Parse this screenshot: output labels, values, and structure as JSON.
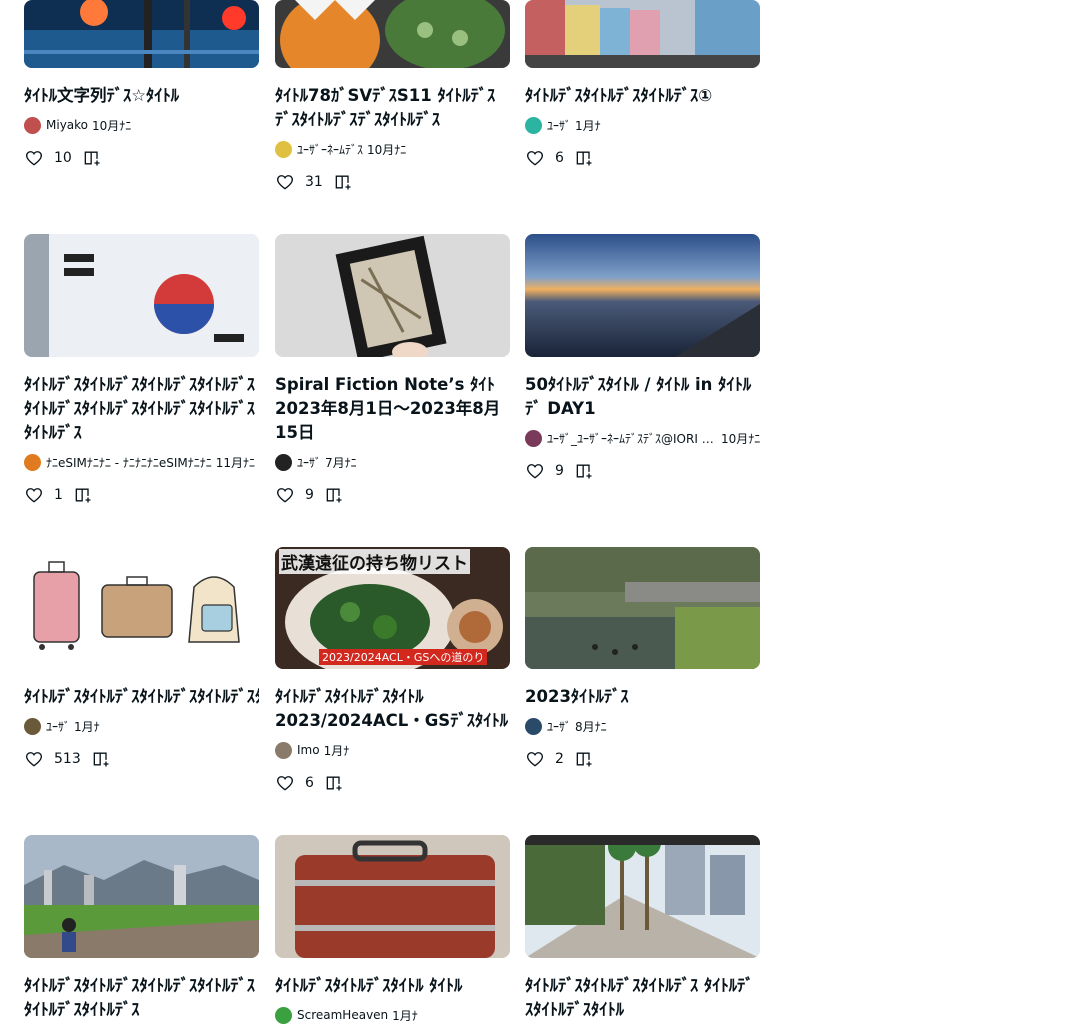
{
  "cards": [
    {
      "title": "ﾀｲﾄﾙ文字列ﾃﾞｽ☆ﾀｲﾄﾙ",
      "author": "Miyako",
      "date": "10月ﾅﾆ",
      "likes": "10",
      "avatar_color": "#c0504d"
    },
    {
      "title": "ﾀｲﾄﾙ78ｶﾞSVﾃﾞｽS11 ﾀｲﾄﾙﾃﾞｽﾃﾞｽﾀｲﾄﾙﾃﾞｽﾃﾞｽﾀｲﾄﾙﾃﾞｽ",
      "author": "ﾕｰｻﾞｰﾈｰﾑﾃﾞｽ",
      "date": "10月ﾅﾆ",
      "likes": "31",
      "avatar_color": "#e0c040"
    },
    {
      "title": "ﾀｲﾄﾙﾃﾞｽﾀｲﾄﾙﾃﾞｽﾀｲﾄﾙﾃﾞｽ①",
      "author": "ﾕｰｻﾞ",
      "date": "1月ﾅ",
      "likes": "6",
      "avatar_color": "#2bb5a0"
    },
    {
      "title": "ﾀｲﾄﾙﾃﾞｽﾀｲﾄﾙﾃﾞｽﾀｲﾄﾙﾃﾞｽﾀｲﾄﾙﾃﾞｽﾀｲﾄﾙﾃﾞｽﾀｲﾄﾙﾃﾞｽﾀｲﾄﾙﾃﾞｽﾀｲﾄﾙﾃﾞｽﾀｲﾄﾙﾃﾞｽ",
      "author": "ﾅﾆeSIMﾅﾆﾅﾆ - ﾅﾆﾅﾆﾅﾆeSIMﾅﾆﾅﾆ",
      "date": "11月ﾅﾆ",
      "likes": "1",
      "avatar_color": "#e07b20"
    },
    {
      "title": "Spiral Fiction Note’s ﾀｲﾄ2023年8月1日～2023年8月15日",
      "author": "ﾕｰｻﾞ",
      "date": "7月ﾅﾆ",
      "likes": "9",
      "avatar_color": "#222222"
    },
    {
      "title": "50ﾀｲﾄﾙﾃﾞｽﾀｲﾄﾙ / ﾀｲﾄﾙ in ﾀｲﾄﾙﾃﾞ DAY1",
      "author": "ﾕｰｻﾞ_ﾕｰｻﾞｰﾈｰﾑﾃﾞｽﾃﾞｽ@IORI STAY",
      "date": "10月ﾅﾆ",
      "likes": "9",
      "avatar_color": "#7a3a5a"
    },
    {
      "title": "ﾀｲﾄﾙﾃﾞｽﾀｲﾄﾙﾃﾞｽﾀｲﾄﾙﾃﾞｽﾀｲﾄﾙﾃﾞｽﾀｲﾄﾙ",
      "author": "ﾕｰｻﾞ",
      "date": "1月ﾅ",
      "likes": "513",
      "avatar_color": "#6b5a3a"
    },
    {
      "title": "ﾀｲﾄﾙﾃﾞｽﾀｲﾄﾙﾃﾞｽﾀｲﾄﾙ 2023/2024ACL・GSﾃﾞｽﾀｲﾄﾙ",
      "author": "Imo",
      "date": "1月ﾅ",
      "likes": "6",
      "avatar_color": "#8a7a6a"
    },
    {
      "title": "2023ﾀｲﾄﾙﾃﾞｽ",
      "author": "ﾕｰｻﾞ",
      "date": "8月ﾅﾆ",
      "likes": "2",
      "avatar_color": "#2a4a6a"
    },
    {
      "title": "ﾀｲﾄﾙﾃﾞｽﾀｲﾄﾙﾃﾞｽﾀｲﾄﾙﾃﾞｽﾀｲﾄﾙﾃﾞｽﾀｲﾄﾙﾃﾞｽﾀｲﾄﾙﾃﾞｽ",
      "author": "",
      "date": "",
      "likes": "",
      "avatar_color": "#888888"
    },
    {
      "title": "ﾀｲﾄﾙﾃﾞｽﾀｲﾄﾙﾃﾞｽﾀｲﾄﾙ ﾀｲﾄﾙ",
      "author": "ScreamHeaven",
      "date": "1月ﾅ",
      "likes": "",
      "avatar_color": "#3aa040"
    },
    {
      "title": "ﾀｲﾄﾙﾃﾞｽﾀｲﾄﾙﾃﾞｽﾀｲﾄﾙﾃﾞｽ ﾀｲﾄﾙﾃﾞｽﾀｲﾄﾙﾃﾞｽﾀｲﾄﾙ",
      "author": "",
      "date": "",
      "likes": "",
      "avatar_color": "#888888"
    }
  ],
  "thumb_texts": {
    "packing_list": "武漢遠征の持ち物リスト",
    "packing_sub": "2023/2024ACL・GSへの道のり"
  },
  "icons": {
    "like": "heart-outline-icon",
    "save": "magazine-add-icon"
  }
}
